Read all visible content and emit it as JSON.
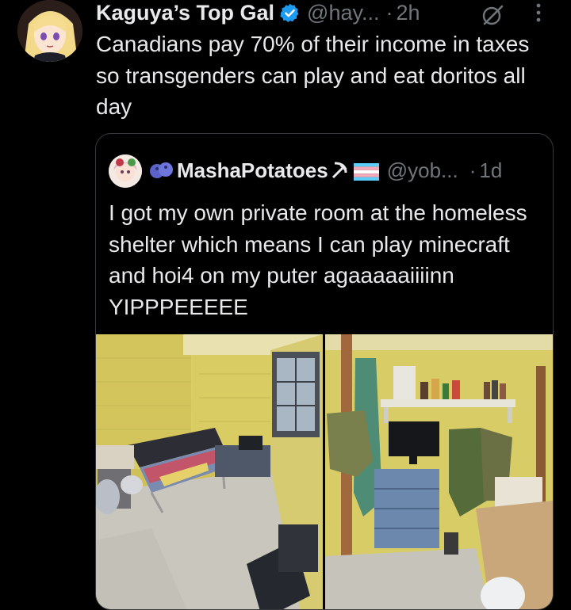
{
  "tweet": {
    "display_name": "Kaguya’s Top Gal",
    "handle": "@hay...",
    "separator": "·",
    "time": "2h",
    "text": "Canadians pay 70% of their income in taxes so transgenders can play and eat doritos all day",
    "icons": [
      "verified-badge-icon",
      "grok-icon",
      "more-options-icon"
    ]
  },
  "quoted_tweet": {
    "display_name": "MashaPotatoes",
    "handle": "@yob...",
    "separator": "·",
    "time": "1d",
    "text": "I got my own private room at the homeless shelter which means I can play minecraft and hoi4 on my puter agaaaaaiiiinn YIPPPEEEEE",
    "name_emoji": [
      "blueberries-emoji",
      "hammer-and-sickle-emoji",
      "transgender-flag-emoji"
    ]
  },
  "colors": {
    "background": "#000000",
    "text_primary": "#e7e9ea",
    "text_secondary": "#71767b",
    "border": "#36393d",
    "verified_blue": "#1d9bf0",
    "wall_yellow": "#d9cc62"
  }
}
